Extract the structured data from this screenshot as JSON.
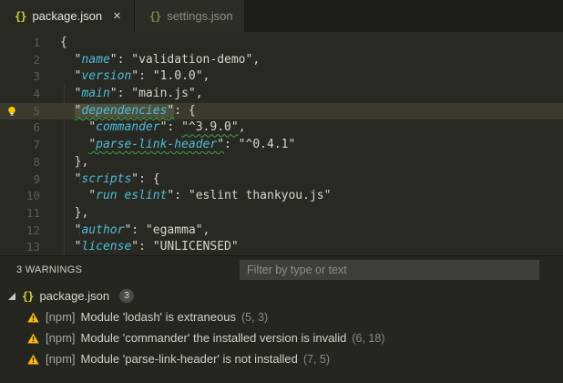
{
  "tabs": [
    {
      "label": "package.json",
      "icon": "{}",
      "close_label": "×",
      "active": true
    },
    {
      "label": "settings.json",
      "icon": "{}",
      "active": false
    }
  ],
  "editor": {
    "lines": {
      "l1": {
        "num": "1",
        "text": "{"
      },
      "l2": {
        "num": "2",
        "pre": "  \"",
        "key": "name",
        "post": "\": \"validation-demo\","
      },
      "l3": {
        "num": "3",
        "pre": "  \"",
        "key": "version",
        "post": "\": \"1.0.0\","
      },
      "l4": {
        "num": "4",
        "pre": "  \"",
        "key": "main",
        "post": "\": \"main.js\","
      },
      "l5": {
        "num": "5",
        "pre": "  ",
        "q1": "\"",
        "key": "dependencies",
        "q2": "\"",
        "post": ": {"
      },
      "l6": {
        "num": "6",
        "pre": "    \"",
        "key": "commander",
        "mid": "\": ",
        "val": "\"^3.9.0\"",
        "post": ","
      },
      "l7": {
        "num": "7",
        "pre": "    ",
        "q1": "\"",
        "key": "parse-link-header",
        "q2": "\"",
        "post": ": \"^0.4.1\""
      },
      "l8": {
        "num": "8",
        "text": "  },"
      },
      "l9": {
        "num": "9",
        "pre": "  \"",
        "key": "scripts",
        "post": "\": {"
      },
      "l10": {
        "num": "10",
        "pre": "    \"",
        "key": "run eslint",
        "post": "\": \"eslint thankyou.js\""
      },
      "l11": {
        "num": "11",
        "text": "  },"
      },
      "l12": {
        "num": "12",
        "pre": "  \"",
        "key": "author",
        "post": "\": \"egamma\","
      },
      "l13": {
        "num": "13",
        "pre": "  \"",
        "key": "license",
        "post": "\": \"UNLICENSED\""
      }
    }
  },
  "problems": {
    "summary": "3 WARNINGS",
    "filter_placeholder": "Filter by type or text",
    "file": {
      "icon": "{}",
      "name": "package.json",
      "badge": "3"
    },
    "items": [
      {
        "source": "[npm]",
        "message": "Module 'lodash' is extraneous",
        "location": "(5, 3)"
      },
      {
        "source": "[npm]",
        "message": "Module 'commander' the installed version is invalid",
        "location": "(6, 18)"
      },
      {
        "source": "[npm]",
        "message": "Module 'parse-link-header' is not installed",
        "location": "(7, 5)"
      }
    ]
  },
  "colors": {
    "key_cyan": "#4fbcd8",
    "squiggle_green": "#3f9e44",
    "warning_yellow": "#fcb714",
    "json_icon_yellow": "#cdd337"
  }
}
